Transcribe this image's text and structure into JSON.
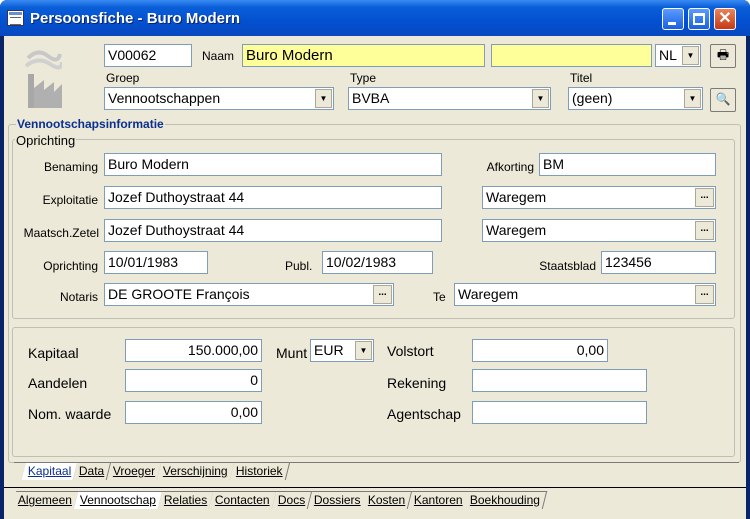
{
  "window": {
    "title": "Persoonsfiche - Buro Modern"
  },
  "header": {
    "code": "V00062",
    "naam_label": "Naam",
    "naam": "Buro Modern",
    "naam2": "",
    "language": "NL",
    "groep_label": "Groep",
    "groep": "Vennootschappen",
    "type_label": "Type",
    "type": "BVBA",
    "titel_label": "Titel",
    "titel": "(geen)"
  },
  "section": {
    "title": "Vennootschapsinformatie",
    "oprichting_title": "Oprichting"
  },
  "oprichting": {
    "benaming_label": "Benaming",
    "benaming": "Buro Modern",
    "afkorting_label": "Afkorting",
    "afkorting": "BM",
    "exploitatie_label": "Exploitatie",
    "exploitatie": "Jozef Duthoystraat 44",
    "exploitatie_city": "Waregem",
    "zetel_label": "Maatsch.Zetel",
    "zetel": "Jozef Duthoystraat 44",
    "zetel_city": "Waregem",
    "oprichting_label": "Oprichting",
    "oprichting_date": "10/01/1983",
    "publ_label": "Publ.",
    "publ_date": "10/02/1983",
    "staatsblad_label": "Staatsblad",
    "staatsblad": "123456",
    "notaris_label": "Notaris",
    "notaris": "DE GROOTE François",
    "te_label": "Te",
    "te": "Waregem"
  },
  "kapitaal": {
    "kapitaal_label": "Kapitaal",
    "kapitaal": "150.000,00",
    "munt_label": "Munt",
    "munt": "EUR",
    "volstort_label": "Volstort",
    "volstort": "0,00",
    "aandelen_label": "Aandelen",
    "aandelen": "0",
    "rekening_label": "Rekening",
    "rekening": "",
    "nom_label": "Nom. waarde",
    "nom": "0,00",
    "agentschap_label": "Agentschap",
    "agentschap": ""
  },
  "subtabs": [
    "Kapitaal",
    "Data",
    "Vroeger",
    "Verschijning",
    "Historiek"
  ],
  "maintabs": [
    "Algemeen",
    "Vennootschap",
    "Relaties",
    "Contacten",
    "Docs",
    "Dossiers",
    "Kosten",
    "Kantoren",
    "Boekhouding"
  ],
  "ellipsis": "...",
  "icons": {
    "print": "printer-icon",
    "search": "search-icon",
    "logo": "factory-icon"
  }
}
